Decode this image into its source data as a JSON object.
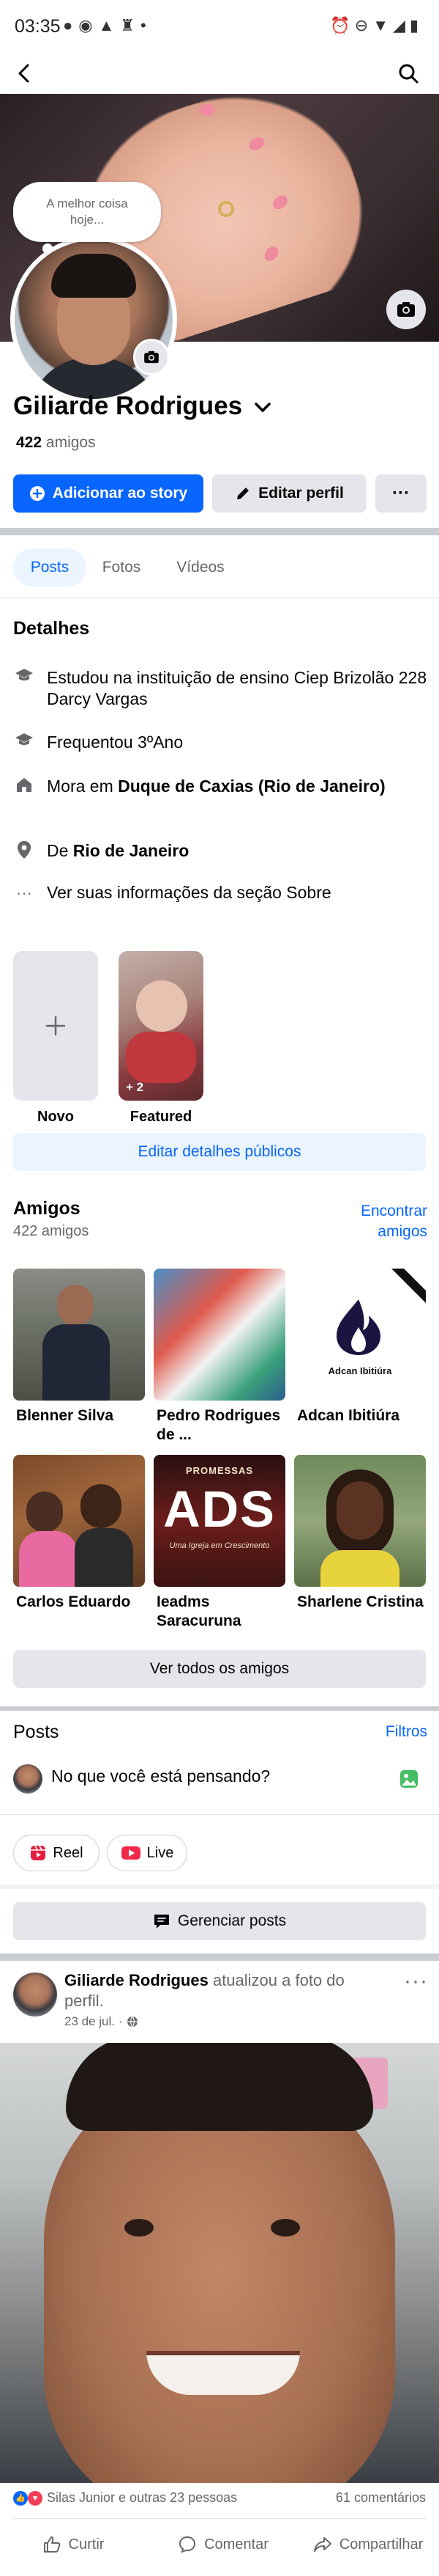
{
  "status_bar": {
    "time": "03:35",
    "left_icons": [
      "message-bubble-icon",
      "whatsapp-icon",
      "graduation-cap-icon",
      "figure-icon",
      "dot-icon"
    ],
    "right_icons": [
      "alarm-icon",
      "minus-circle-icon",
      "wifi-icon",
      "signal-icon",
      "battery-icon"
    ]
  },
  "topbar": {
    "back_icon": "arrow-left-icon",
    "search_icon": "search-icon"
  },
  "profile": {
    "note": "A melhor coisa hoje...",
    "name": "Giliarde Rodrigues",
    "friends_count": "422",
    "friends_label": "amigos",
    "buttons": {
      "add_story": "Adicionar ao story",
      "edit_profile": "Editar perfil",
      "more": "···"
    }
  },
  "tabs": [
    {
      "label": "Posts",
      "active": true
    },
    {
      "label": "Fotos",
      "active": false
    },
    {
      "label": "Vídeos",
      "active": false
    }
  ],
  "details": {
    "title": "Detalhes",
    "rows": [
      {
        "icon": "graduation-cap-icon",
        "text": "Estudou na instituição de ensino Ciep Brizolão 228 Darcy Vargas"
      },
      {
        "icon": "graduation-cap-icon",
        "text": "Frequentou 3ºAno"
      },
      {
        "icon": "home-icon",
        "prefix": "Mora em ",
        "bold": "Duque de Caxias (Rio de Janeiro)"
      },
      {
        "icon": "location-pin-icon",
        "prefix": "De ",
        "bold": "Rio de Janeiro"
      },
      {
        "icon": "ellipsis-icon",
        "text": "Ver suas informações da seção Sobre"
      }
    ]
  },
  "highlights": {
    "new_label": "Novo",
    "featured_label": "Featured",
    "featured_count": "+ 2",
    "edit_public": "Editar detalhes públicos"
  },
  "friends": {
    "title": "Amigos",
    "count": "422 amigos",
    "find_link": "Encontrar amigos",
    "list": [
      {
        "name": "Blenner Silva"
      },
      {
        "name": "Pedro Rodrigues de ..."
      },
      {
        "name": "Adcan Ibitiúra",
        "photo_text": "Adcan Ibitiúra"
      },
      {
        "name": "Carlos Eduardo"
      },
      {
        "name": "Ieadms Saracuruna",
        "photo_text_top": "PROMESSAS",
        "photo_text_main": "ADS",
        "photo_text_bottom": "Uma Igreja em Crescimento"
      },
      {
        "name": "Sharlene Cristina"
      }
    ],
    "see_all": "Ver todos os amigos"
  },
  "posts_section": {
    "title": "Posts",
    "filters": "Filtros",
    "composer_placeholder": "No que você está pensando?",
    "chips": [
      {
        "label": "Reel",
        "icon": "reel-icon",
        "color": "#e41e3f"
      },
      {
        "label": "Live",
        "icon": "live-icon",
        "color": "#f02849"
      }
    ],
    "manage_posts": "Gerenciar posts"
  },
  "post": {
    "author": "Giliarde Rodrigues",
    "action": " atualizou a foto do perfil.",
    "date": "23 de jul. ·",
    "privacy_icon": "globe-icon",
    "reactions_text": "Silas Junior e outras 23 pessoas",
    "comments": "61 comentários",
    "actions": [
      "Curtir",
      "Comentar",
      "Compartilhar"
    ]
  },
  "colors": {
    "accent": "#0866ff",
    "accent_light": "#ebf5ff",
    "secondary_button": "#e4e6eb",
    "muted_text": "#65676b",
    "divider": "#c9ccd1"
  }
}
